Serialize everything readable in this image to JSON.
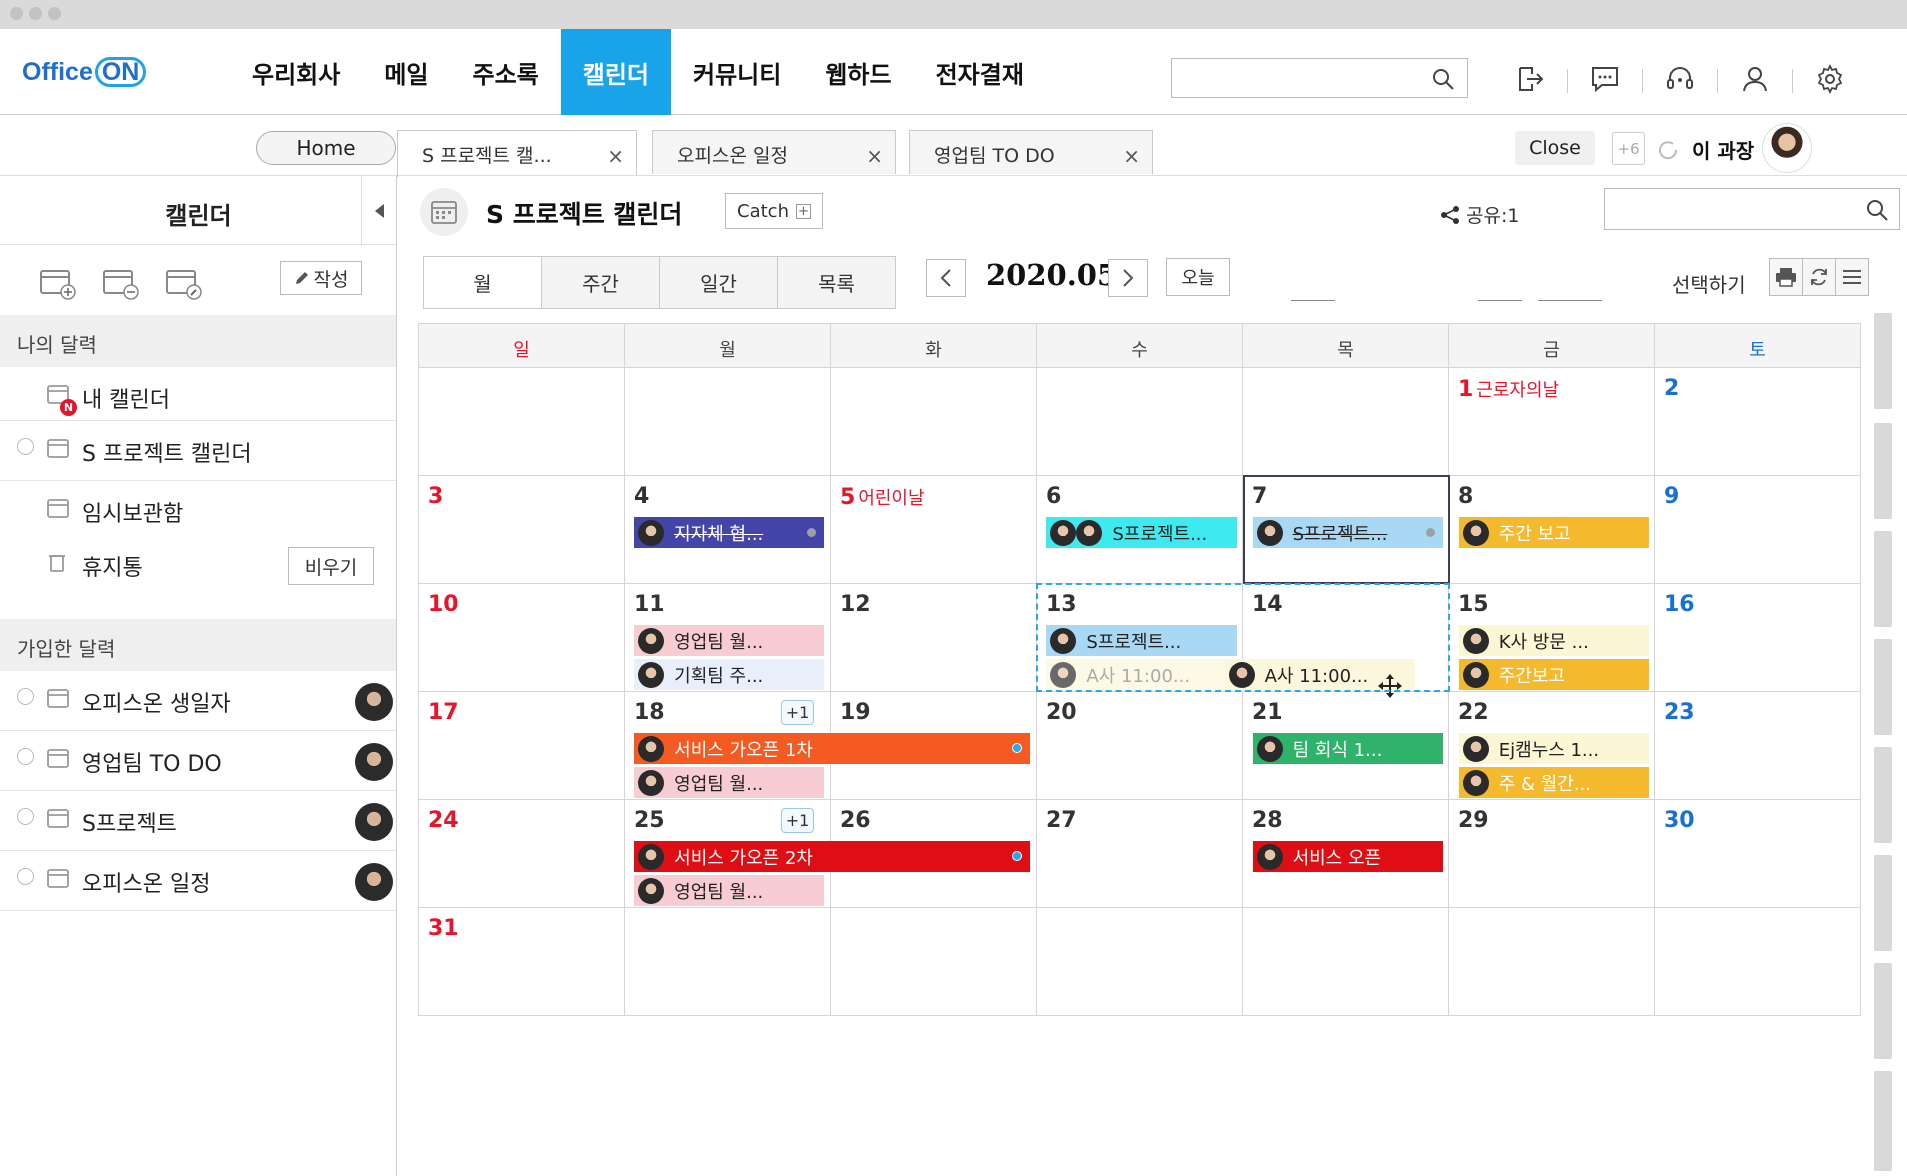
{
  "logo": {
    "text": "Office",
    "on": "ON"
  },
  "menu": [
    "우리회사",
    "메일",
    "주소록",
    "캘린더",
    "커뮤니티",
    "웹하드",
    "전자결재"
  ],
  "menu_active_index": 3,
  "tabs": {
    "home": "Home",
    "items": [
      {
        "label": "S 프로젝트 캘...",
        "close": "×"
      },
      {
        "label": "오피스온 일정",
        "close": "×"
      },
      {
        "label": "영업팀 TO DO",
        "close": "×"
      }
    ],
    "close": "Close",
    "more": "+6",
    "user": "이 과장"
  },
  "sidebar": {
    "title": "캘린더",
    "write": "작성",
    "my_section": "나의 달력",
    "my_items": [
      "내 캘린더",
      "S 프로젝트 캘린더",
      "임시보관함",
      "휴지통"
    ],
    "badge": "N",
    "empty": "비우기",
    "joined_section": "가입한 달력",
    "joined_items": [
      "오피스온 생일자",
      "영업팀 TO DO",
      "S프로젝트",
      "오피스온 일정"
    ]
  },
  "calendar": {
    "title": "S 프로젝트 캘린더",
    "catch": "Catch",
    "catch_plus": "+",
    "share": "공유:1",
    "views": [
      "월",
      "주간",
      "일간",
      "목록"
    ],
    "month": "2020.05",
    "today": "오늘",
    "select": "선택하기",
    "dow": [
      "일",
      "월",
      "화",
      "수",
      "목",
      "금",
      "토"
    ],
    "weeks": [
      [
        {
          "d": ""
        },
        {
          "d": ""
        },
        {
          "d": ""
        },
        {
          "d": ""
        },
        {
          "d": ""
        },
        {
          "d": "1",
          "h": "근로자의날"
        },
        {
          "d": "2"
        }
      ],
      [
        {
          "d": "3"
        },
        {
          "d": "4"
        },
        {
          "d": "5",
          "h": "어린이날"
        },
        {
          "d": "6"
        },
        {
          "d": "7"
        },
        {
          "d": "8"
        },
        {
          "d": "9"
        }
      ],
      [
        {
          "d": "10"
        },
        {
          "d": "11"
        },
        {
          "d": "12"
        },
        {
          "d": "13"
        },
        {
          "d": "14"
        },
        {
          "d": "15"
        },
        {
          "d": "16"
        }
      ],
      [
        {
          "d": "17"
        },
        {
          "d": "18",
          "more": "+1"
        },
        {
          "d": "19"
        },
        {
          "d": "20"
        },
        {
          "d": "21"
        },
        {
          "d": "22"
        },
        {
          "d": "23"
        }
      ],
      [
        {
          "d": "24"
        },
        {
          "d": "25",
          "more": "+1"
        },
        {
          "d": "26"
        },
        {
          "d": "27"
        },
        {
          "d": "28"
        },
        {
          "d": "29"
        },
        {
          "d": "30"
        }
      ],
      [
        {
          "d": "31"
        },
        {
          "d": ""
        },
        {
          "d": ""
        },
        {
          "d": ""
        },
        {
          "d": ""
        },
        {
          "d": ""
        },
        {
          "d": ""
        }
      ]
    ],
    "events": [
      {
        "w": 1,
        "c": 1,
        "row": 0,
        "span": 1,
        "text": "지자체 협...",
        "bg": "#4346a8",
        "fg": "#ffffff",
        "strike": true,
        "dot": "gray"
      },
      {
        "w": 1,
        "c": 3,
        "row": 0,
        "span": 1,
        "text": "S프로젝트...",
        "bg": "#3fe9f0",
        "fg": "#222222",
        "two": true
      },
      {
        "w": 1,
        "c": 4,
        "row": 0,
        "span": 1,
        "text": "S프로젝트...",
        "bg": "#a9d8f5",
        "fg": "#222222",
        "strike": true,
        "dot": "gray"
      },
      {
        "w": 1,
        "c": 5,
        "row": 0,
        "span": 1,
        "text": "주간 보고",
        "bg": "#f5b92e",
        "fg": "#ffffff"
      },
      {
        "w": 2,
        "c": 1,
        "row": 0,
        "span": 1,
        "text": "영업팀 월...",
        "bg": "#f8ccd3",
        "fg": "#222222"
      },
      {
        "w": 2,
        "c": 1,
        "row": 1,
        "span": 1,
        "text": "기획팀 주...",
        "bg": "#e9eefb",
        "fg": "#222222"
      },
      {
        "w": 2,
        "c": 3,
        "row": 0,
        "span": 1,
        "text": "S프로젝트...",
        "bg": "#a9d8f5",
        "fg": "#222222"
      },
      {
        "w": 2,
        "c": 3,
        "row": 1,
        "span": 1,
        "text": "A사 11:00...",
        "bg": "#fbf7dd",
        "fg": "#888888",
        "faded": true
      },
      {
        "w": 2,
        "c": 4,
        "row": 1,
        "span": 1,
        "text": "A사 11:00...",
        "bg": "#fbf7dd",
        "fg": "#222222",
        "drag": true
      },
      {
        "w": 2,
        "c": 5,
        "row": 0,
        "span": 1,
        "text": "K사 방문 ...",
        "bg": "#fbf7d4",
        "fg": "#222222"
      },
      {
        "w": 2,
        "c": 5,
        "row": 1,
        "span": 1,
        "text": "주간보고",
        "bg": "#f5b92e",
        "fg": "#ffffff"
      },
      {
        "w": 3,
        "c": 1,
        "row": 0,
        "span": 2,
        "text": "서비스 가오픈 1차",
        "bg": "#f45a22",
        "fg": "#ffffff",
        "dot": "blue"
      },
      {
        "w": 3,
        "c": 1,
        "row": 1,
        "span": 1,
        "text": "영업팀 월...",
        "bg": "#f8ccd3",
        "fg": "#222222"
      },
      {
        "w": 3,
        "c": 4,
        "row": 0,
        "span": 1,
        "text": "팀 회식 1...",
        "bg": "#2fb36b",
        "fg": "#ffffff"
      },
      {
        "w": 3,
        "c": 5,
        "row": 0,
        "span": 1,
        "text": "Ej캠누스 1...",
        "bg": "#fbf7d4",
        "fg": "#222222"
      },
      {
        "w": 3,
        "c": 5,
        "row": 1,
        "span": 1,
        "text": "주 & 월간...",
        "bg": "#f5b92e",
        "fg": "#ffffff"
      },
      {
        "w": 4,
        "c": 1,
        "row": 0,
        "span": 2,
        "text": "서비스 가오픈 2차",
        "bg": "#df0e14",
        "fg": "#ffffff",
        "dot": "blue"
      },
      {
        "w": 4,
        "c": 1,
        "row": 1,
        "span": 1,
        "text": "영업팀 월...",
        "bg": "#f8ccd3",
        "fg": "#222222"
      },
      {
        "w": 4,
        "c": 4,
        "row": 0,
        "span": 1,
        "text": "서비스 오픈",
        "bg": "#df0e14",
        "fg": "#ffffff"
      }
    ]
  }
}
